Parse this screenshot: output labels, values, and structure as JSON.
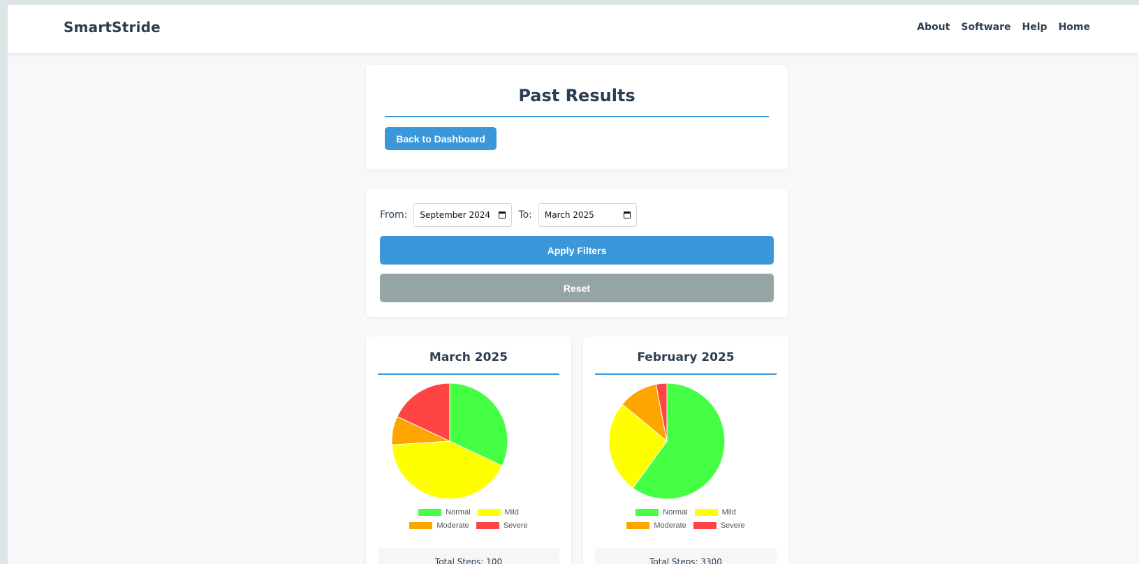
{
  "app": {
    "brand": "SmartStride",
    "nav": [
      "About",
      "Software",
      "Help",
      "Home"
    ]
  },
  "header_card": {
    "title": "Past Results",
    "back_button": "Back to Dashboard"
  },
  "filters": {
    "from_label": "From:",
    "from_value": "September 2024",
    "to_label": "To:",
    "to_value": "March 2025",
    "apply_label": "Apply Filters",
    "reset_label": "Reset"
  },
  "colors": {
    "accent": "#3a97d9",
    "reset": "#95a5a6",
    "normal": "#44ff44",
    "mild": "#ffff00",
    "moderate": "#ffa500",
    "severe": "#ff4444"
  },
  "legend_labels": [
    "Normal",
    "Mild",
    "Moderate",
    "Severe"
  ],
  "chart_data": [
    {
      "type": "pie",
      "title": "March 2025",
      "categories": [
        "Normal",
        "Mild",
        "Moderate",
        "Severe"
      ],
      "values": [
        32,
        42,
        8,
        18
      ],
      "colors": [
        "#44ff44",
        "#ffff00",
        "#ffa500",
        "#ff4444"
      ],
      "legend": "bottom",
      "total_label": "Total Steps: 100"
    },
    {
      "type": "pie",
      "title": "February 2025",
      "categories": [
        "Normal",
        "Mild",
        "Moderate",
        "Severe"
      ],
      "values": [
        60,
        26,
        11,
        3
      ],
      "colors": [
        "#44ff44",
        "#ffff00",
        "#ffa500",
        "#ff4444"
      ],
      "legend": "bottom",
      "total_label": "Total Steps: 3300"
    }
  ]
}
